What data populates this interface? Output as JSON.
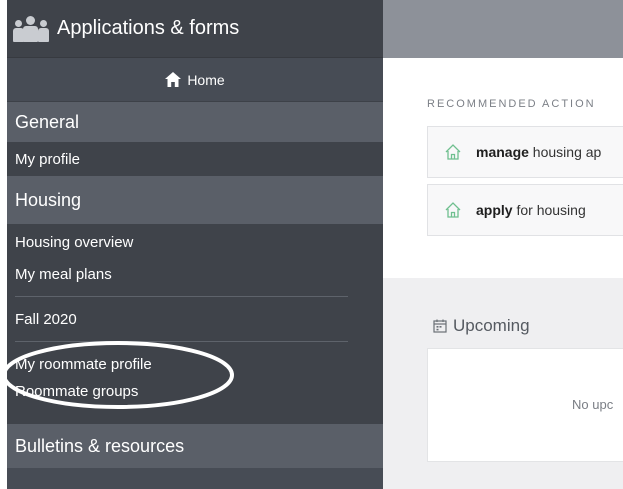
{
  "app": {
    "title": "Applications & forms"
  },
  "nav": {
    "home_label": "Home",
    "sections": [
      {
        "title": "General",
        "items": [
          "My profile"
        ]
      },
      {
        "title": "Housing",
        "items": [
          "Housing overview",
          "My meal plans",
          "Fall 2020",
          "My roommate profile",
          "Roommate groups"
        ]
      },
      {
        "title": "Bulletins & resources",
        "items": []
      }
    ]
  },
  "main": {
    "recommended_title": "RECOMMENDED ACTION",
    "actions": [
      {
        "verb": "manage",
        "rest": " housing ap"
      },
      {
        "verb": "apply",
        "rest": " for housing"
      }
    ],
    "upcoming": {
      "title": "Upcoming",
      "empty_text": "No upc"
    }
  },
  "colors": {
    "sidebar": "#474c55",
    "section_header": "#5a5f68",
    "topbar": "#8d9199",
    "house_icon": "#6fbf8f",
    "highlight": "#ffffff"
  },
  "icons": [
    "people-icon",
    "home-icon",
    "house-outline-icon",
    "calendar-icon"
  ]
}
